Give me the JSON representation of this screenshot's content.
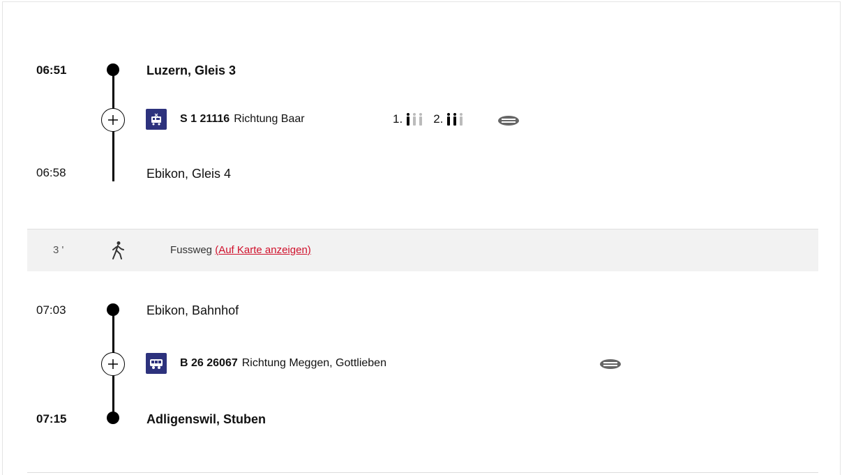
{
  "leg1": {
    "dep_time": "06:51",
    "dep_stop": "Luzern, Gleis 3",
    "line_number": "S 1 21116",
    "direction": "Richtung Baar",
    "first_class_label": "1.",
    "second_class_label": "2.",
    "arr_time": "06:58",
    "arr_stop": "Ebikon, Gleis 4",
    "occupancy_first_of_3": 1,
    "occupancy_second_of_3": 2
  },
  "walk": {
    "minutes": "3 '",
    "label": "Fussweg",
    "map_link": "(Auf Karte anzeigen)"
  },
  "leg2": {
    "dep_time": "07:03",
    "dep_stop": "Ebikon, Bahnhof",
    "line_number": "B 26 26067",
    "direction": "Richtung Meggen, Gottlieben",
    "arr_time": "07:15",
    "arr_stop": "Adligenswil, Stuben"
  },
  "icons": {
    "train": "train-icon",
    "bus": "bus-icon",
    "walk": "walking-person-icon",
    "mask": "face-mask-icon",
    "expand": "plus-icon"
  },
  "colors": {
    "vehicle_bg": "#2d327d",
    "link": "#d0102b",
    "band": "#f2f2f2"
  }
}
